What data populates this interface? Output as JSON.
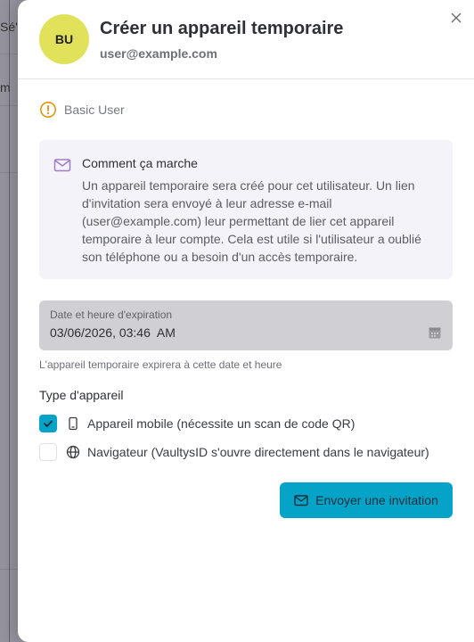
{
  "background": {
    "text_fragments": [
      "Sé'e",
      "m"
    ]
  },
  "drawer": {
    "avatar_initials": "BU",
    "title": "Créer un appareil temporaire",
    "email": "user@example.com",
    "role_label": "Basic User",
    "info": {
      "title": "Comment ça marche",
      "text": "Un appareil temporaire sera créé pour cet utilisateur. Un lien d'invitation sera envoyé à leur adresse e-mail (user@example.com) leur permettant de lier cet appareil temporaire à leur compte. Cela est utile si l'utilisateur a oublié son téléphone ou a besoin d'un accès temporaire."
    },
    "expiration": {
      "label": "Date et heure d'expiration",
      "value": "03/06/2026, 03:46  AM",
      "helper": "L'appareil temporaire expirera à cette date et heure"
    },
    "device_type": {
      "label": "Type d'appareil",
      "options": [
        {
          "label": "Appareil mobile (nécessite un scan de code QR)",
          "checked": true,
          "icon": "smartphone-icon"
        },
        {
          "label": "Navigateur (VaultysID s'ouvre directement dans le navigateur)",
          "checked": false,
          "icon": "globe-icon"
        }
      ]
    },
    "send_button_label": "Envoyer une invitation"
  },
  "colors": {
    "accent": "#06a3c9",
    "avatar": "#e2e25a",
    "warning": "#e8930c",
    "info_bg": "#f5f3fa"
  }
}
